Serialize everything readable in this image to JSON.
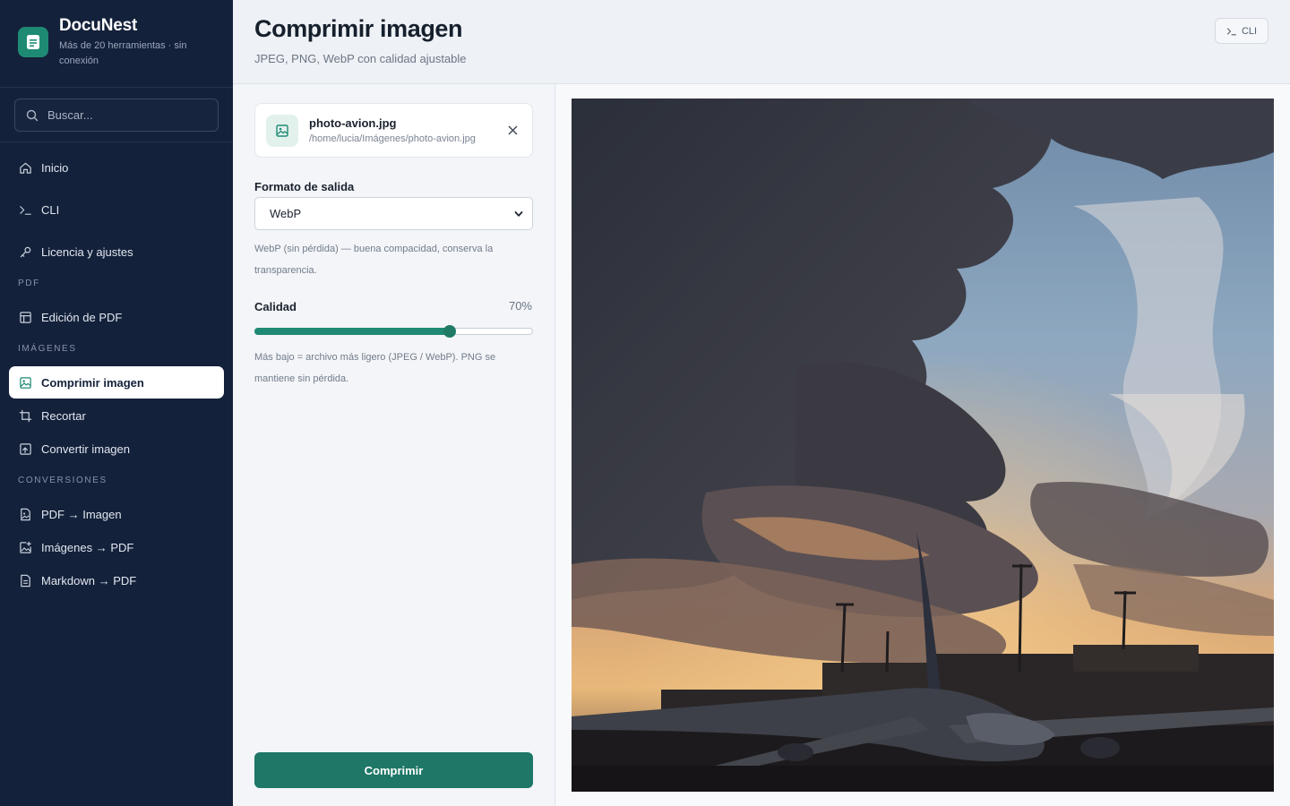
{
  "app": {
    "name": "DocuNest",
    "tagline": "Más de 20 herramientas · sin conexión"
  },
  "search": {
    "placeholder": "Buscar..."
  },
  "sidebar": {
    "items": [
      {
        "label": "Inicio",
        "icon": "home-icon"
      },
      {
        "label": "CLI",
        "icon": "terminal-icon"
      },
      {
        "label": "Licencia y ajustes",
        "icon": "key-icon"
      }
    ],
    "sections": [
      {
        "title": "PDF",
        "items": [
          {
            "label": "Edición de PDF",
            "icon": "layout-icon"
          }
        ]
      },
      {
        "title": "IMÁGENES",
        "items": [
          {
            "label": "Comprimir imagen",
            "icon": "image-compress-icon",
            "active": true
          },
          {
            "label": "Recortar",
            "icon": "crop-icon"
          },
          {
            "label": "Convertir imagen",
            "icon": "image-convert-icon"
          }
        ]
      },
      {
        "title": "CONVERSIONES",
        "items": [
          {
            "label": "PDF → Imagen",
            "icon": "file-image-icon"
          },
          {
            "label": "Imágenes → PDF",
            "icon": "image-plus-icon"
          },
          {
            "label": "Markdown → PDF",
            "icon": "file-text-icon"
          }
        ]
      }
    ]
  },
  "header": {
    "title": "Comprimir imagen",
    "subtitle": "JPEG, PNG, WebP con calidad ajustable",
    "cli_label": "CLI"
  },
  "file": {
    "name": "photo-avion.jpg",
    "path": "/home/lucia/Imágenes/photo-avion.jpg"
  },
  "format": {
    "label": "Formato de salida",
    "selected": "WebP",
    "help": "WebP (sin pérdida) — buena compacidad, conserva la transparencia."
  },
  "quality": {
    "label": "Calidad",
    "value_text": "70%",
    "value": 0.7,
    "help": "Más bajo = archivo más ligero (JPEG / WebP). PNG se mantiene sin pérdida."
  },
  "action": {
    "compress_label": "Comprimir"
  },
  "colors": {
    "accent": "#1f8a74",
    "sidebar_bg": "#14213a",
    "button_bg": "#1e7767"
  }
}
